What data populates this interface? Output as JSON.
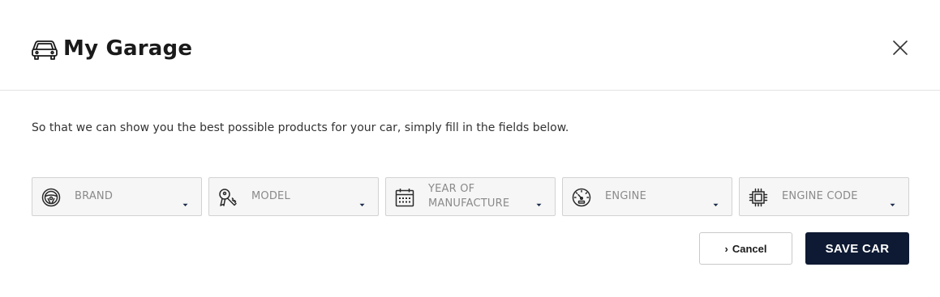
{
  "header": {
    "icon": "car-icon",
    "title": "My Garage",
    "close_icon": "close-icon"
  },
  "intro_text": "So that we can show you the best possible products for your car, simply fill in the fields below.",
  "fields": [
    {
      "icon": "steering-wheel-icon",
      "label": "BRAND"
    },
    {
      "icon": "car-key-icon",
      "label": "MODEL"
    },
    {
      "icon": "calendar-icon",
      "label": "YEAR OF MANUFACTURE"
    },
    {
      "icon": "speedometer-icon",
      "label": "ENGINE"
    },
    {
      "icon": "chip-icon",
      "label": "ENGINE CODE"
    }
  ],
  "actions": {
    "cancel_label": "Cancel",
    "save_label": "SAVE CAR"
  },
  "colors": {
    "primary_button": "#0e1a33",
    "field_background": "#f6f6f6",
    "caret": "#1a2a4a"
  }
}
